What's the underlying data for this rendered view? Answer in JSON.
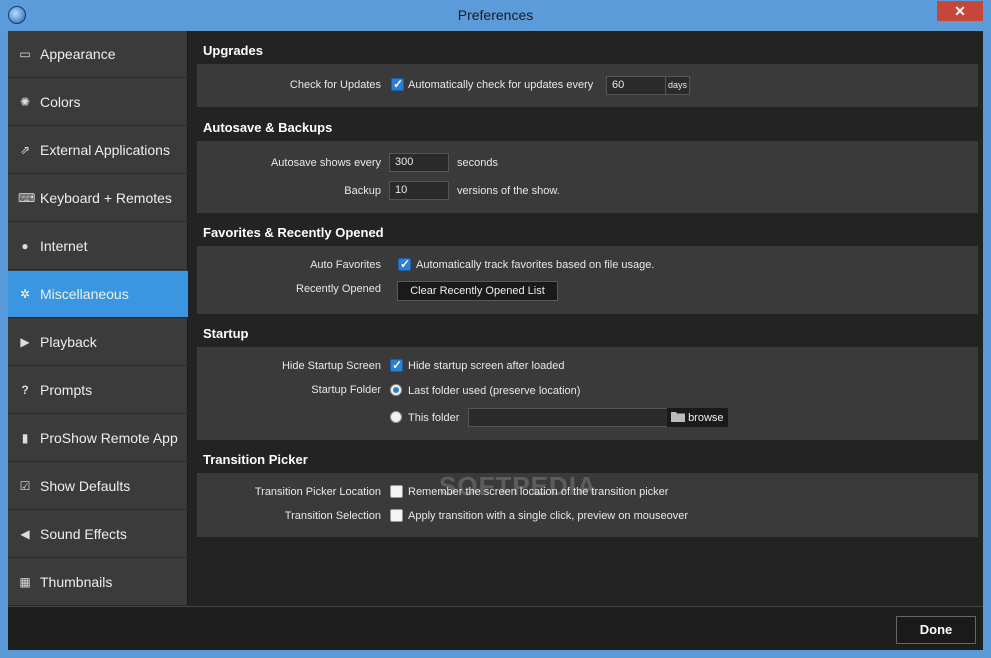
{
  "window": {
    "title": "Preferences",
    "close_glyph": "✕"
  },
  "sidebar": {
    "items": [
      {
        "label": "Appearance",
        "icon": "window-icon",
        "glyph": "▭"
      },
      {
        "label": "Colors",
        "icon": "color-wheel-icon",
        "glyph": "✺"
      },
      {
        "label": "External Applications",
        "icon": "external-app-icon",
        "glyph": "⇗"
      },
      {
        "label": "Keyboard + Remotes",
        "icon": "keyboard-icon",
        "glyph": "⌨"
      },
      {
        "label": "Internet",
        "icon": "globe-icon",
        "glyph": "●"
      },
      {
        "label": "Miscellaneous",
        "icon": "gear-icon",
        "glyph": "✲"
      },
      {
        "label": "Playback",
        "icon": "play-icon",
        "glyph": "▶"
      },
      {
        "label": "Prompts",
        "icon": "question-icon",
        "glyph": "?"
      },
      {
        "label": "ProShow Remote App",
        "icon": "remote-icon",
        "glyph": "▮"
      },
      {
        "label": "Show Defaults",
        "icon": "checkbox-icon",
        "glyph": "☑"
      },
      {
        "label": "Sound Effects",
        "icon": "speaker-icon",
        "glyph": "◀"
      },
      {
        "label": "Thumbnails",
        "icon": "thumbnail-icon",
        "glyph": "▦"
      }
    ],
    "active": "Miscellaneous"
  },
  "upgrades": {
    "title": "Upgrades",
    "check_label": "Check for Updates",
    "check_text": "Automatically check for updates every",
    "check_checked": true,
    "days_value": "60",
    "days_unit": "days"
  },
  "autosave": {
    "title": "Autosave & Backups",
    "autosave_label": "Autosave shows every",
    "autosave_value": "300",
    "autosave_unit": "seconds",
    "backup_label": "Backup",
    "backup_value": "10",
    "backup_unit": "versions of the show."
  },
  "favorites": {
    "title": "Favorites & Recently Opened",
    "auto_label": "Auto Favorites",
    "auto_text": "Automatically track favorites based on file usage.",
    "auto_checked": true,
    "recent_label": "Recently Opened",
    "clear_button": "Clear Recently Opened List"
  },
  "startup": {
    "title": "Startup",
    "hide_label": "Hide Startup Screen",
    "hide_text": "Hide startup screen after loaded",
    "hide_checked": true,
    "folder_label": "Startup Folder",
    "last_folder_text": "Last folder used (preserve location)",
    "this_folder_text": "This folder",
    "this_folder_value": "",
    "browse_label": "browse",
    "selected": "last"
  },
  "transition": {
    "title": "Transition Picker",
    "location_label": "Transition Picker Location",
    "location_text": "Remember the screen location of the transition picker",
    "location_checked": false,
    "selection_label": "Transition Selection",
    "selection_text": "Apply transition with a single click, preview on mouseover",
    "selection_checked": false
  },
  "footer": {
    "done_label": "Done"
  },
  "watermark": "SOFTPEDIA",
  "colors": {
    "accent": "#3a96e0",
    "titlebar": "#5c9bda",
    "close": "#c7463a"
  }
}
